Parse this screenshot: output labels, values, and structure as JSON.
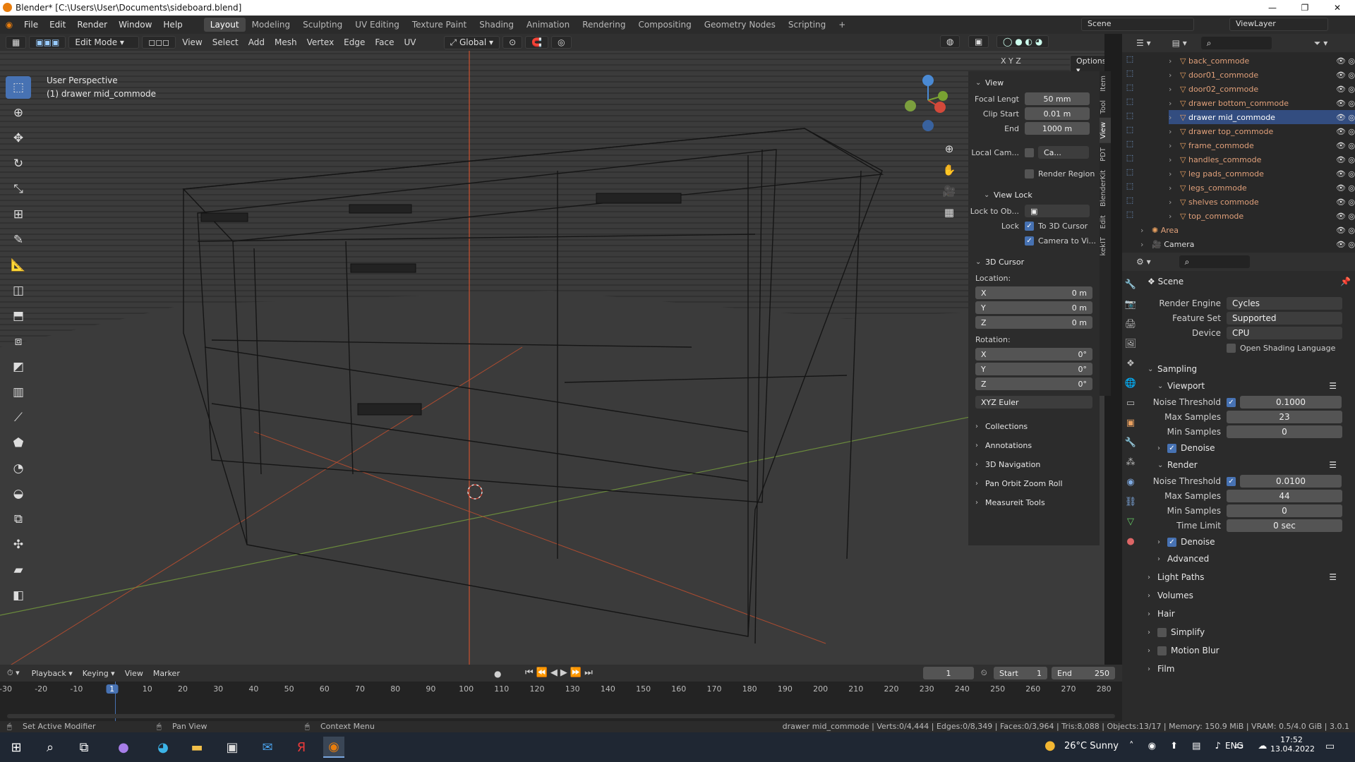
{
  "window": {
    "title": "Blender* [C:\\Users\\User\\Documents\\sideboard.blend]",
    "min_icon": "minimize-icon",
    "max_icon": "maximize-icon",
    "close_icon": "close-icon"
  },
  "menubar": {
    "items": [
      "File",
      "Edit",
      "Render",
      "Window",
      "Help"
    ]
  },
  "workspaces": [
    "Layout",
    "Modeling",
    "Sculpting",
    "UV Editing",
    "Texture Paint",
    "Shading",
    "Animation",
    "Rendering",
    "Compositing",
    "Geometry Nodes",
    "Scripting",
    "+"
  ],
  "active_workspace": "Layout",
  "scene_name": "Scene",
  "viewlayer_name": "ViewLayer",
  "header3d": {
    "mode": "Edit Mode",
    "menus": [
      "View",
      "Select",
      "Add",
      "Mesh",
      "Vertex",
      "Edge",
      "Face",
      "UV"
    ],
    "transform": "Global",
    "options": "Options",
    "axes": [
      "X",
      "Y",
      "Z"
    ]
  },
  "viewport": {
    "perspective": "User Perspective",
    "object": "(1) drawer mid_commode"
  },
  "npanel": {
    "tabs": [
      "Item",
      "Tool",
      "View",
      "PDT",
      "BlenderKit",
      "Edit",
      "kekIT"
    ],
    "view_section": "View",
    "focal_label": "Focal Lengt",
    "focal": "50 mm",
    "clip_start_label": "Clip Start",
    "clip_start": "0.01 m",
    "end_label": "End",
    "end": "1000 m",
    "local_cam_label": "Local Cam...",
    "local_cam": "Ca...",
    "render_region": "Render Region",
    "view_lock": "View Lock",
    "lock_to_label": "Lock to Ob...",
    "lock_label": "Lock",
    "to_cursor": "To 3D Cursor",
    "camera_to": "Camera to Vi...",
    "cursor_section": "3D Cursor",
    "location_label": "Location:",
    "loc": [
      {
        "axis": "X",
        "val": "0 m"
      },
      {
        "axis": "Y",
        "val": "0 m"
      },
      {
        "axis": "Z",
        "val": "0 m"
      }
    ],
    "rotation_label": "Rotation:",
    "rot": [
      {
        "axis": "X",
        "val": "0°"
      },
      {
        "axis": "Y",
        "val": "0°"
      },
      {
        "axis": "Z",
        "val": "0°"
      }
    ],
    "euler": "XYZ Euler",
    "collapsed": [
      "Collections",
      "Annotations",
      "3D Navigation",
      "Pan Orbit Zoom Roll",
      "Measureit Tools"
    ]
  },
  "outliner": {
    "items": [
      {
        "name": "back_commode",
        "selected": false
      },
      {
        "name": "door01_commode",
        "selected": false
      },
      {
        "name": "door02_commode",
        "selected": false
      },
      {
        "name": "drawer bottom_commode",
        "selected": false
      },
      {
        "name": "drawer mid_commode",
        "selected": true
      },
      {
        "name": "drawer top_commode",
        "selected": false
      },
      {
        "name": "frame_commode",
        "selected": false
      },
      {
        "name": "handles_commode",
        "selected": false
      },
      {
        "name": "leg pads_commode",
        "selected": false
      },
      {
        "name": "legs_commode",
        "selected": false
      },
      {
        "name": "shelves commode",
        "selected": false
      },
      {
        "name": "top_commode",
        "selected": false
      }
    ],
    "extras": [
      "Area",
      "Camera"
    ]
  },
  "props": {
    "scene": "Scene",
    "render_engine_label": "Render Engine",
    "render_engine": "Cycles",
    "feature_set_label": "Feature Set",
    "feature_set": "Supported",
    "device_label": "Device",
    "device": "CPU",
    "osl": "Open Shading Language",
    "sampling": "Sampling",
    "viewport": "Viewport",
    "noise_label": "Noise Threshold",
    "vp_noise": "0.1000",
    "max_label": "Max Samples",
    "vp_max": "23",
    "min_label": "Min Samples",
    "vp_min": "0",
    "denoise": "Denoise",
    "render": "Render",
    "r_noise": "0.0100",
    "r_max": "44",
    "r_min": "0",
    "time_label": "Time Limit",
    "time": "0 sec",
    "advanced": "Advanced",
    "collapsed": [
      "Light Paths",
      "Volumes",
      "Hair",
      "Simplify",
      "Motion Blur",
      "Film"
    ]
  },
  "timeline": {
    "menus": [
      "Playback",
      "Keying",
      "View",
      "Marker"
    ],
    "current": "1",
    "start_label": "Start",
    "start": "1",
    "end_label": "End",
    "end": "250",
    "ticks": [
      "-30",
      "-20",
      "-10",
      "1",
      "10",
      "20",
      "30",
      "40",
      "50",
      "60",
      "70",
      "80",
      "90",
      "100",
      "110",
      "120",
      "130",
      "140",
      "150",
      "160",
      "170",
      "180",
      "190",
      "200",
      "210",
      "220",
      "230",
      "240",
      "250",
      "260",
      "270",
      "280"
    ]
  },
  "status": {
    "left1": "Set Active Modifier",
    "left2": "Pan View",
    "left3": "Context Menu",
    "stats": "drawer mid_commode | Verts:0/4,444 | Edges:0/8,349 | Faces:0/3,964 | Tris:8,088 | Objects:13/17 | Memory: 150.9 MiB | VRAM: 0.5/4.0 GiB | 3.0.1"
  },
  "taskbar": {
    "weather": "26°C Sunny",
    "lang": "ENG",
    "time": "17:52",
    "date": "13.04.2022"
  },
  "colors": {
    "accent": "#4772b3",
    "selected_row": "#334d80",
    "object_orange": "#e0a07a"
  }
}
